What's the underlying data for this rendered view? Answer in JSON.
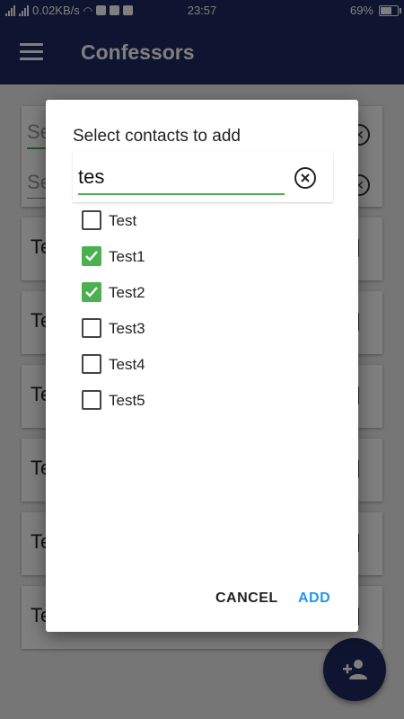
{
  "status_bar": {
    "network_speed": "0.02KB/s",
    "time": "23:57",
    "battery": "69%",
    "battery_level": 0.69,
    "icons": [
      "signal-icon",
      "wifi-icon",
      "shield-icon",
      "youtube-icon",
      "facebook-icon",
      "battery-icon"
    ]
  },
  "app_bar": {
    "title": "Confessors",
    "menu_icon": "menu-icon"
  },
  "background": {
    "search_placeholder_1": "Se",
    "search_placeholder_2": "Se",
    "list_items": [
      "Te",
      "Te",
      "Te",
      "Te",
      "Te",
      "Te"
    ]
  },
  "dialog": {
    "title": "Select contacts to add",
    "search_value": "tes",
    "clear_icon": "clear-circle-icon",
    "contacts": [
      {
        "name": "Test",
        "checked": false
      },
      {
        "name": "Test1",
        "checked": true
      },
      {
        "name": "Test2",
        "checked": true
      },
      {
        "name": "Test3",
        "checked": false
      },
      {
        "name": "Test4",
        "checked": false
      },
      {
        "name": "Test5",
        "checked": false
      }
    ],
    "cancel_label": "CANCEL",
    "add_label": "ADD"
  },
  "fab": {
    "icon": "add-person-icon"
  },
  "colors": {
    "primary": "#1f2a63",
    "accent": "#2196f3",
    "check": "#4caf50"
  }
}
